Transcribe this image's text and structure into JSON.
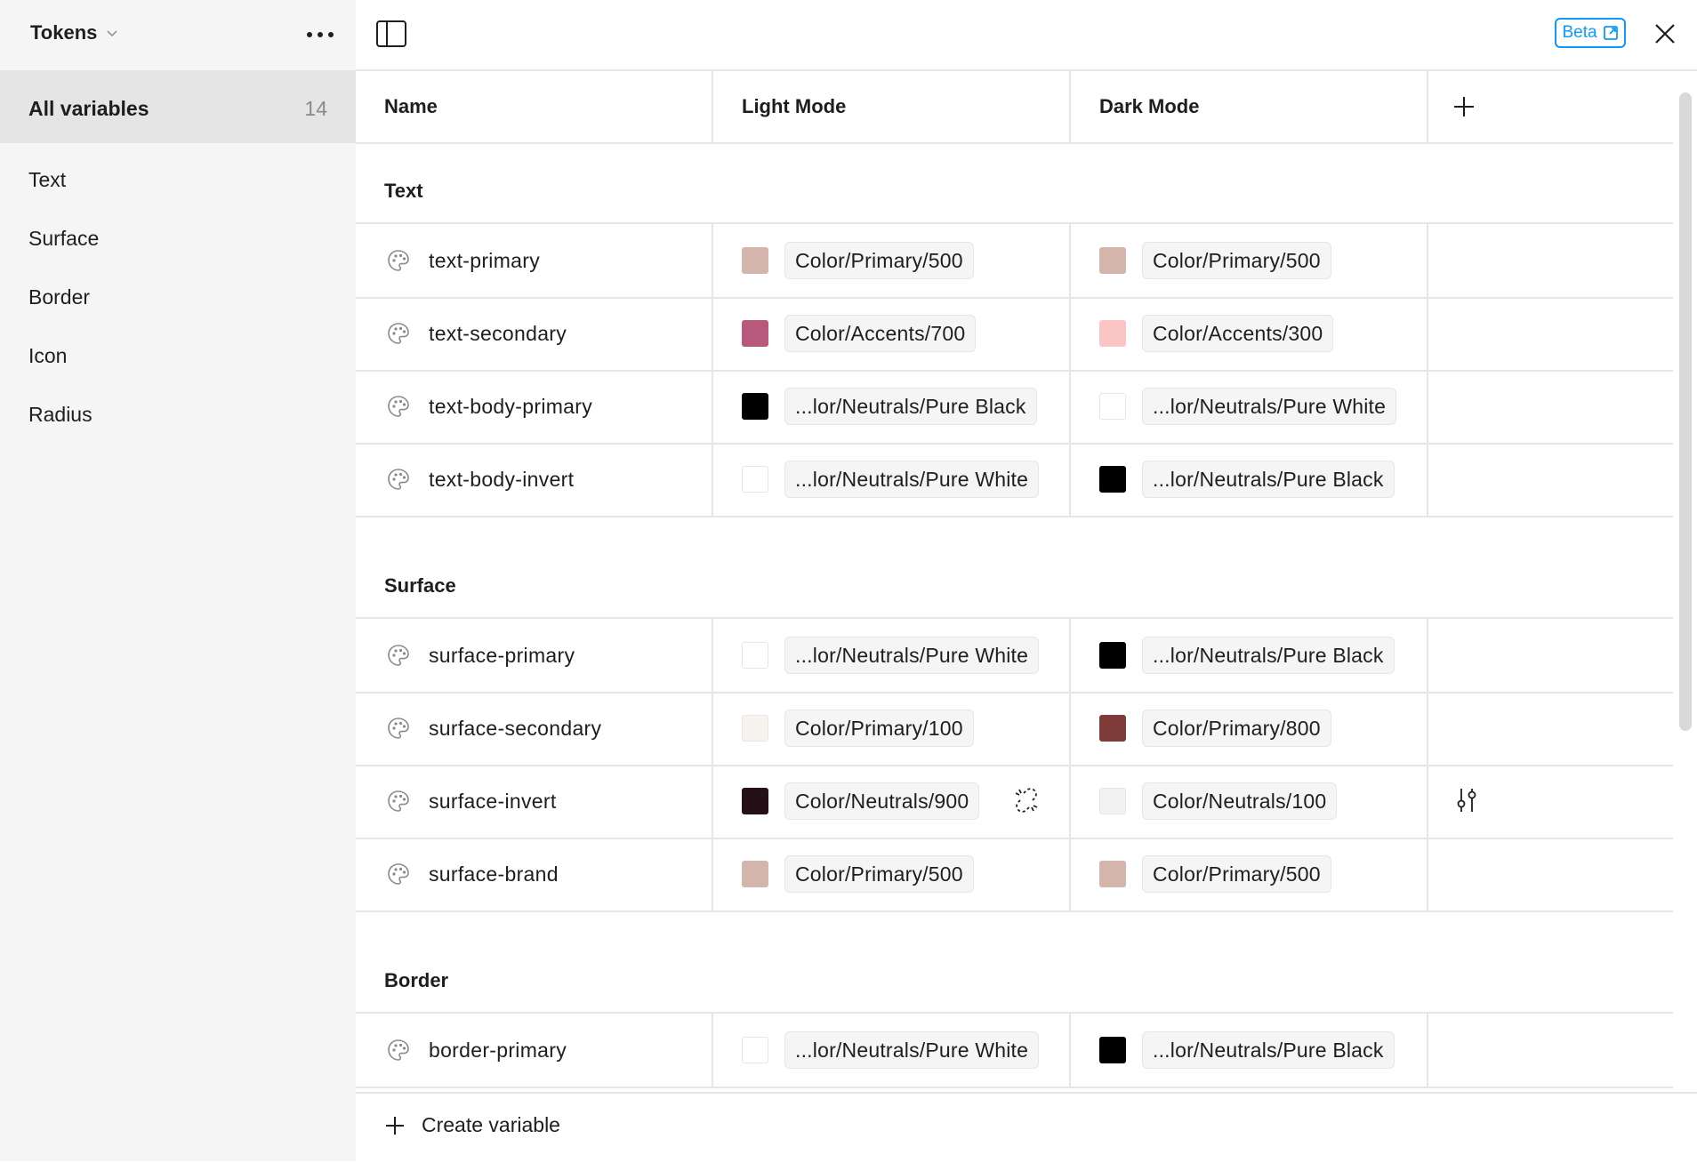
{
  "sidebar": {
    "collection_title": "Tokens",
    "all_variables": {
      "label": "All variables",
      "count": "14"
    },
    "items": [
      {
        "label": "Text"
      },
      {
        "label": "Surface"
      },
      {
        "label": "Border"
      },
      {
        "label": "Icon"
      },
      {
        "label": "Radius"
      }
    ]
  },
  "topbar": {
    "beta_label": "Beta"
  },
  "table": {
    "columns": {
      "name": "Name",
      "light": "Light Mode",
      "dark": "Dark Mode"
    },
    "groups": [
      {
        "label": "Text",
        "rows": [
          {
            "name": "text-primary",
            "light": {
              "value": "Color/Primary/500",
              "color": "#d4b5ab"
            },
            "dark": {
              "value": "Color/Primary/500",
              "color": "#d4b5ab"
            }
          },
          {
            "name": "text-secondary",
            "light": {
              "value": "Color/Accents/700",
              "color": "#b8587a"
            },
            "dark": {
              "value": "Color/Accents/300",
              "color": "#fbc5c5"
            }
          },
          {
            "name": "text-body-primary",
            "light": {
              "value": "...lor/Neutrals/Pure Black",
              "color": "#000000"
            },
            "dark": {
              "value": "...lor/Neutrals/Pure White",
              "color": "#ffffff"
            }
          },
          {
            "name": "text-body-invert",
            "light": {
              "value": "...lor/Neutrals/Pure White",
              "color": "#ffffff"
            },
            "dark": {
              "value": "...lor/Neutrals/Pure Black",
              "color": "#000000"
            }
          }
        ]
      },
      {
        "label": "Surface",
        "rows": [
          {
            "name": "surface-primary",
            "light": {
              "value": "...lor/Neutrals/Pure White",
              "color": "#ffffff"
            },
            "dark": {
              "value": "...lor/Neutrals/Pure Black",
              "color": "#000000"
            }
          },
          {
            "name": "surface-secondary",
            "light": {
              "value": "Color/Primary/100",
              "color": "#f7f3ef"
            },
            "dark": {
              "value": "Color/Primary/800",
              "color": "#7e3b3a"
            }
          },
          {
            "name": "surface-invert",
            "light": {
              "value": "Color/Neutrals/900",
              "color": "#241016"
            },
            "dark": {
              "value": "Color/Neutrals/100",
              "color": "#f2f2f2"
            }
          },
          {
            "name": "surface-brand",
            "light": {
              "value": "Color/Primary/500",
              "color": "#d4b5ab"
            },
            "dark": {
              "value": "Color/Primary/500",
              "color": "#d4b5ab"
            }
          }
        ]
      },
      {
        "label": "Border",
        "rows": [
          {
            "name": "border-primary",
            "light": {
              "value": "...lor/Neutrals/Pure White",
              "color": "#ffffff"
            },
            "dark": {
              "value": "...lor/Neutrals/Pure Black",
              "color": "#000000"
            }
          }
        ]
      }
    ]
  },
  "footer": {
    "create_label": "Create variable"
  },
  "colors": {
    "accent": "#0d99ff",
    "sidebar_bg": "#f5f5f5",
    "selected_bg": "#e5e5e5",
    "divider": "#e6e6e6"
  },
  "icons": [
    "chevron-down-icon",
    "more-icon",
    "panel-toggle-icon",
    "external-link-icon",
    "close-icon",
    "plus-icon",
    "color-palette-icon",
    "detach-link-icon",
    "adjust-icon"
  ]
}
